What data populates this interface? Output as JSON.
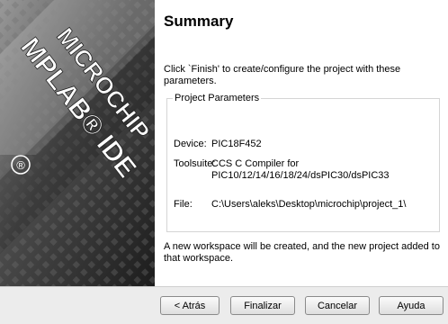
{
  "banner": {
    "logo_lines": [
      "MICROCHIP",
      "MPLAB® IDE"
    ],
    "registered_mark": "®"
  },
  "page": {
    "title": "Summary",
    "intro": "Click `Finish' to create/configure the project with these parameters."
  },
  "parameters": {
    "legend": "Project Parameters",
    "device_label": "Device:",
    "device_value": "PIC18F452",
    "toolsuite_label": "Toolsuite:",
    "toolsuite_value_line1": "CCS C Compiler for",
    "toolsuite_value_line2": "PIC10/12/14/16/18/24/dsPIC30/dsPIC33",
    "file_label": "File:",
    "file_value": "C:\\Users\\aleks\\Desktop\\microchip\\project_1\\"
  },
  "outro": "A new workspace will be created, and the new project added to that workspace.",
  "buttons": {
    "back": "< Atrás",
    "finish": "Finalizar",
    "cancel": "Cancelar",
    "help": "Ayuda"
  }
}
